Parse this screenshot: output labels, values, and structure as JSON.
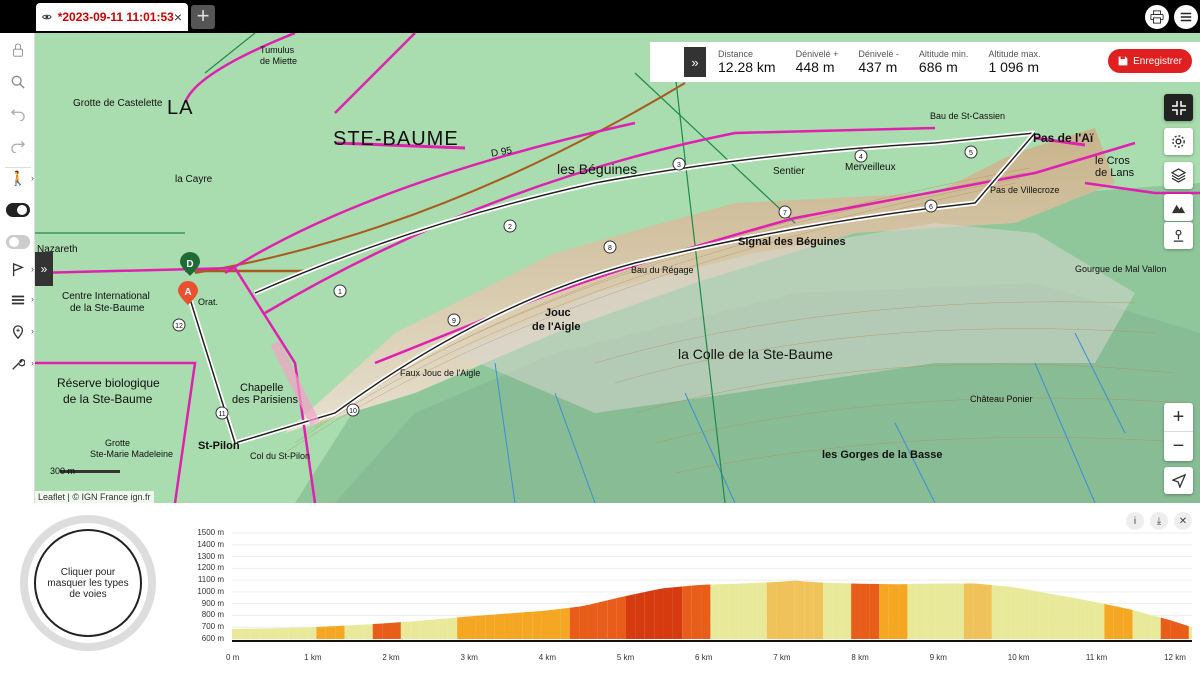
{
  "tab": {
    "title": "*2023-09-11 11:01:53",
    "close": "×",
    "new": "+"
  },
  "stats": {
    "distance": {
      "label": "Distance",
      "value": "12.28 km"
    },
    "gain": {
      "label": "Dénivelé +",
      "value": "448 m"
    },
    "loss": {
      "label": "Dénivelé -",
      "value": "437 m"
    },
    "alt_min": {
      "label": "Altitude min.",
      "value": "686 m"
    },
    "alt_max": {
      "label": "Altitude max.",
      "value": "1 096 m"
    },
    "save": "Enregistrer"
  },
  "map": {
    "labels": {
      "ste_baume": "STE-BAUME",
      "la": "LA",
      "beguines_les": "les Béguines",
      "signal": "Signal des Béguines",
      "colle": "la Colle de la Ste-Baume",
      "jouc": "Jouc",
      "de_laigle": "de l'Aigle",
      "pas_ai": "Pas de l'Aï",
      "cros": "le Cros",
      "lans": "de Lans",
      "gorges": "les Gorges de la Basse",
      "reserve1": "Réserve biologique",
      "reserve2": "de la Ste-Baume",
      "chapelle1": "Chapelle",
      "chapelle2": "des Parisiens",
      "centre1": "Centre International",
      "centre2": "de la Ste-Baume",
      "st_pilon": "St-Pilon",
      "col": "Col du St-Pilon",
      "grotte1": "Grotte",
      "grotte2": "Ste-Marie Madeleine",
      "grotte_castelette": "Grotte de Castelette",
      "tumulus1": "Tumulus",
      "tumulus2": "de Miette",
      "nazareth": "Nazareth",
      "cayre": "la Cayre",
      "sentier": "Sentier",
      "merveilleux": "Merveilleux",
      "bau_cassien": "Bau de St-Cassien",
      "pas_villecroze": "Pas de Villecroze",
      "bau_regage": "Bau du Régage",
      "chateau_ponier": "Château Ponier",
      "gourgue": "Gourgue de Mal Vallon",
      "faux_jouc": "Faux Jouc de l'Aigle",
      "d95": "D 95",
      "orat": "Orat.",
      "scale": "300 m"
    },
    "waypoints": [
      "1",
      "2",
      "3",
      "4",
      "5",
      "6",
      "7",
      "8",
      "9",
      "10",
      "11",
      "12"
    ],
    "marker_start": "A",
    "marker_end": "D",
    "attribution": "Leaflet | © IGN France ign.fr",
    "zoom_in": "+",
    "zoom_out": "−"
  },
  "profile": {
    "legend_text": "Cliquer pour masquer les types de voies",
    "y_ticks": [
      "1500 m",
      "1400 m",
      "1300 m",
      "1200 m",
      "1100 m",
      "1000 m",
      "900 m",
      "800 m",
      "700 m",
      "600 m"
    ],
    "x_ticks": [
      "0 m",
      "1 km",
      "2 km",
      "3 km",
      "4 km",
      "5 km",
      "6 km",
      "7 km",
      "8 km",
      "9 km",
      "10 km",
      "11 km",
      "12 km"
    ]
  },
  "chart_data": {
    "type": "area",
    "x": [
      0,
      0.5,
      1,
      1.5,
      2,
      2.5,
      3,
      3.5,
      4,
      4.5,
      5,
      5.5,
      6,
      6.5,
      7,
      7.2,
      7.5,
      8,
      8.5,
      9,
      9.5,
      10,
      10.5,
      11,
      11.5,
      12,
      12.28
    ],
    "y": [
      686,
      690,
      700,
      715,
      735,
      760,
      790,
      815,
      840,
      880,
      960,
      1030,
      1060,
      1070,
      1085,
      1096,
      1080,
      1070,
      1065,
      1070,
      1072,
      1040,
      980,
      920,
      850,
      760,
      700
    ],
    "xlim": [
      0,
      12.28
    ],
    "ylim": [
      600,
      1500
    ],
    "colors": [
      "#e8ea9a",
      "#f5a623",
      "#e85d1a",
      "#d63a0f",
      "#a0300e",
      "#f0c25a"
    ]
  }
}
